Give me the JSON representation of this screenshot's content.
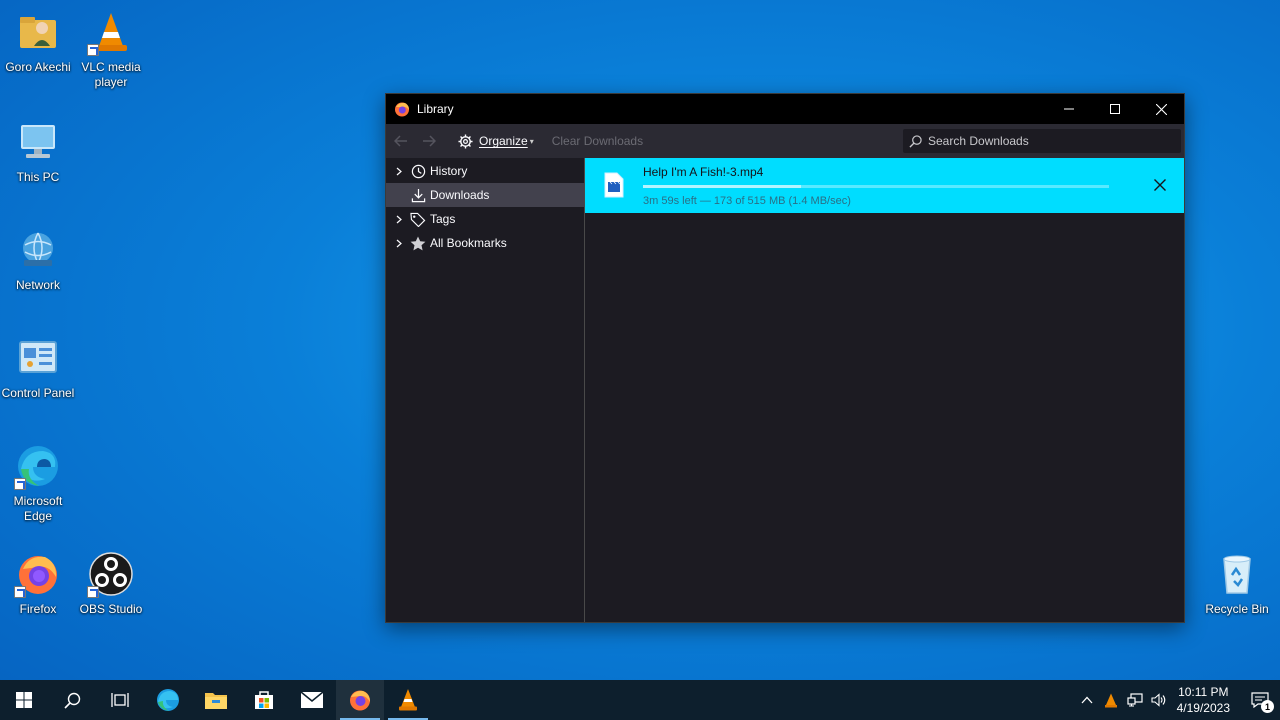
{
  "desktop": {
    "icons": [
      {
        "label": "Goro Akechi",
        "icon": "user-folder-icon"
      },
      {
        "label": "VLC media player",
        "icon": "vlc-icon"
      },
      {
        "label": "This PC",
        "icon": "computer-icon"
      },
      {
        "label": "Network",
        "icon": "network-icon"
      },
      {
        "label": "Control Panel",
        "icon": "control-panel-icon"
      },
      {
        "label": "Microsoft Edge",
        "icon": "edge-icon"
      },
      {
        "label": "Firefox",
        "icon": "firefox-icon"
      },
      {
        "label": "OBS Studio",
        "icon": "obs-icon"
      },
      {
        "label": "Recycle Bin",
        "icon": "recycle-bin-icon"
      }
    ]
  },
  "window": {
    "title": "Library",
    "toolbar": {
      "organize_label": "Organize",
      "clear_label": "Clear Downloads",
      "search_placeholder": "Search Downloads"
    },
    "sidebar": {
      "items": [
        {
          "label": "History",
          "icon": "clock-icon",
          "expandable": true
        },
        {
          "label": "Downloads",
          "icon": "download-icon",
          "expandable": false,
          "selected": true
        },
        {
          "label": "Tags",
          "icon": "tag-icon",
          "expandable": true
        },
        {
          "label": "All Bookmarks",
          "icon": "star-icon",
          "expandable": true
        }
      ]
    },
    "downloads": [
      {
        "filename": "Help I'm A Fish!-3.mp4",
        "status": "3m 59s left — 173 of 515 MB (1.4 MB/sec)",
        "progress": 0.34
      }
    ]
  },
  "taskbar": {
    "clock_time": "10:11 PM",
    "clock_date": "4/19/2023",
    "notification_count": "1"
  },
  "colors": {
    "accent_cyan": "#00ddff",
    "taskbar": "#0d1f2d",
    "window_bg": "#1c1b22"
  }
}
